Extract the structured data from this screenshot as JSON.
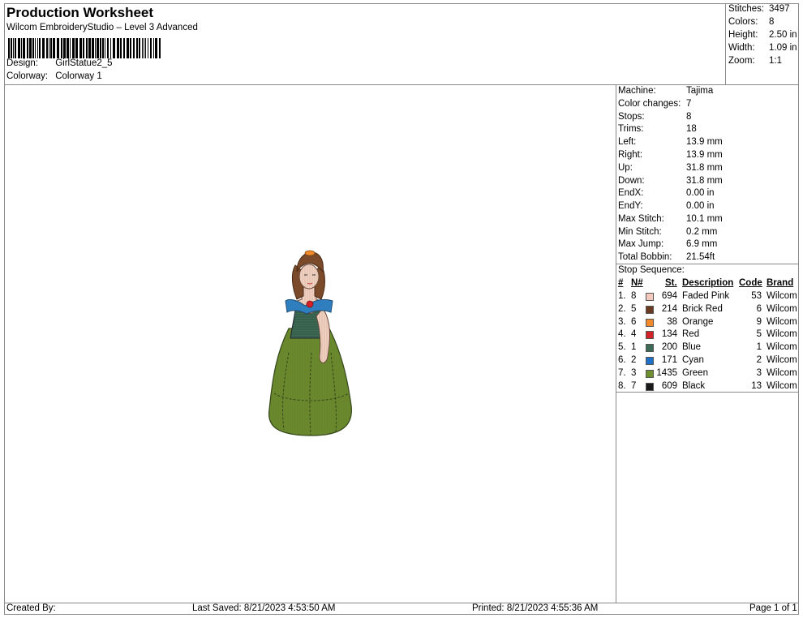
{
  "header": {
    "title": "Production Worksheet",
    "subtitle": "Wilcom EmbroideryStudio – Level 3 Advanced",
    "design_label": "Design:",
    "design_value": "GirlStatue2_5",
    "colorway_label": "Colorway:",
    "colorway_value": "Colorway 1"
  },
  "summary": [
    {
      "label": "Stitches:",
      "value": "3497"
    },
    {
      "label": "Colors:",
      "value": "8"
    },
    {
      "label": "Height:",
      "value": "2.50 in"
    },
    {
      "label": "Width:",
      "value": "1.09 in"
    },
    {
      "label": "Zoom:",
      "value": "1:1"
    }
  ],
  "machine_info": [
    {
      "label": "Machine:",
      "value": "Tajima"
    },
    {
      "label": "Color changes:",
      "value": "7"
    },
    {
      "label": "Stops:",
      "value": "8"
    },
    {
      "label": "Trims:",
      "value": "18"
    },
    {
      "label": "Left:",
      "value": "13.9 mm"
    },
    {
      "label": "Right:",
      "value": "13.9 mm"
    },
    {
      "label": "Up:",
      "value": "31.8 mm"
    },
    {
      "label": "Down:",
      "value": "31.8 mm"
    },
    {
      "label": "EndX:",
      "value": "0.00 in"
    },
    {
      "label": "EndY:",
      "value": "0.00 in"
    },
    {
      "label": "Max Stitch:",
      "value": "10.1 mm"
    },
    {
      "label": "Min Stitch:",
      "value": "0.2 mm"
    },
    {
      "label": "Max Jump:",
      "value": "6.9 mm"
    },
    {
      "label": "Total Bobbin:",
      "value": "21.54ft"
    }
  ],
  "stop_sequence": {
    "title": "Stop Sequence:",
    "headers": {
      "num": "#",
      "n": "N#",
      "st": "St.",
      "desc": "Description",
      "code": "Code",
      "brand": "Brand"
    },
    "rows": [
      {
        "num": "1.",
        "n": "8",
        "color": "#f4c9bd",
        "st": "694",
        "desc": "Faded Pink",
        "code": "53",
        "brand": "Wilcom"
      },
      {
        "num": "2.",
        "n": "5",
        "color": "#6b3a22",
        "st": "214",
        "desc": "Brick Red",
        "code": "6",
        "brand": "Wilcom"
      },
      {
        "num": "3.",
        "n": "6",
        "color": "#f08a2a",
        "st": "38",
        "desc": "Orange",
        "code": "9",
        "brand": "Wilcom"
      },
      {
        "num": "4.",
        "n": "4",
        "color": "#d42128",
        "st": "134",
        "desc": "Red",
        "code": "5",
        "brand": "Wilcom"
      },
      {
        "num": "5.",
        "n": "1",
        "color": "#3b6b57",
        "st": "200",
        "desc": "Blue",
        "code": "1",
        "brand": "Wilcom"
      },
      {
        "num": "6.",
        "n": "2",
        "color": "#1f6fc4",
        "st": "171",
        "desc": "Cyan",
        "code": "2",
        "brand": "Wilcom"
      },
      {
        "num": "7.",
        "n": "3",
        "color": "#6f8f2c",
        "st": "1435",
        "desc": "Green",
        "code": "3",
        "brand": "Wilcom"
      },
      {
        "num": "8.",
        "n": "7",
        "color": "#1a1a1a",
        "st": "609",
        "desc": "Black",
        "code": "13",
        "brand": "Wilcom"
      }
    ]
  },
  "footer": {
    "created_by": "Created By:",
    "last_saved": "Last Saved: 8/21/2023 4:53:50 AM",
    "printed": "Printed: 8/21/2023 4:55:36 AM",
    "page": "Page 1 of 1"
  },
  "design_colors": {
    "skin": "#f2d3c3",
    "hair": "#7a4a2a",
    "blue": "#2f7fbf",
    "bodice": "#3e6b55",
    "dress": "#6b8a2e",
    "outline": "#333333"
  }
}
